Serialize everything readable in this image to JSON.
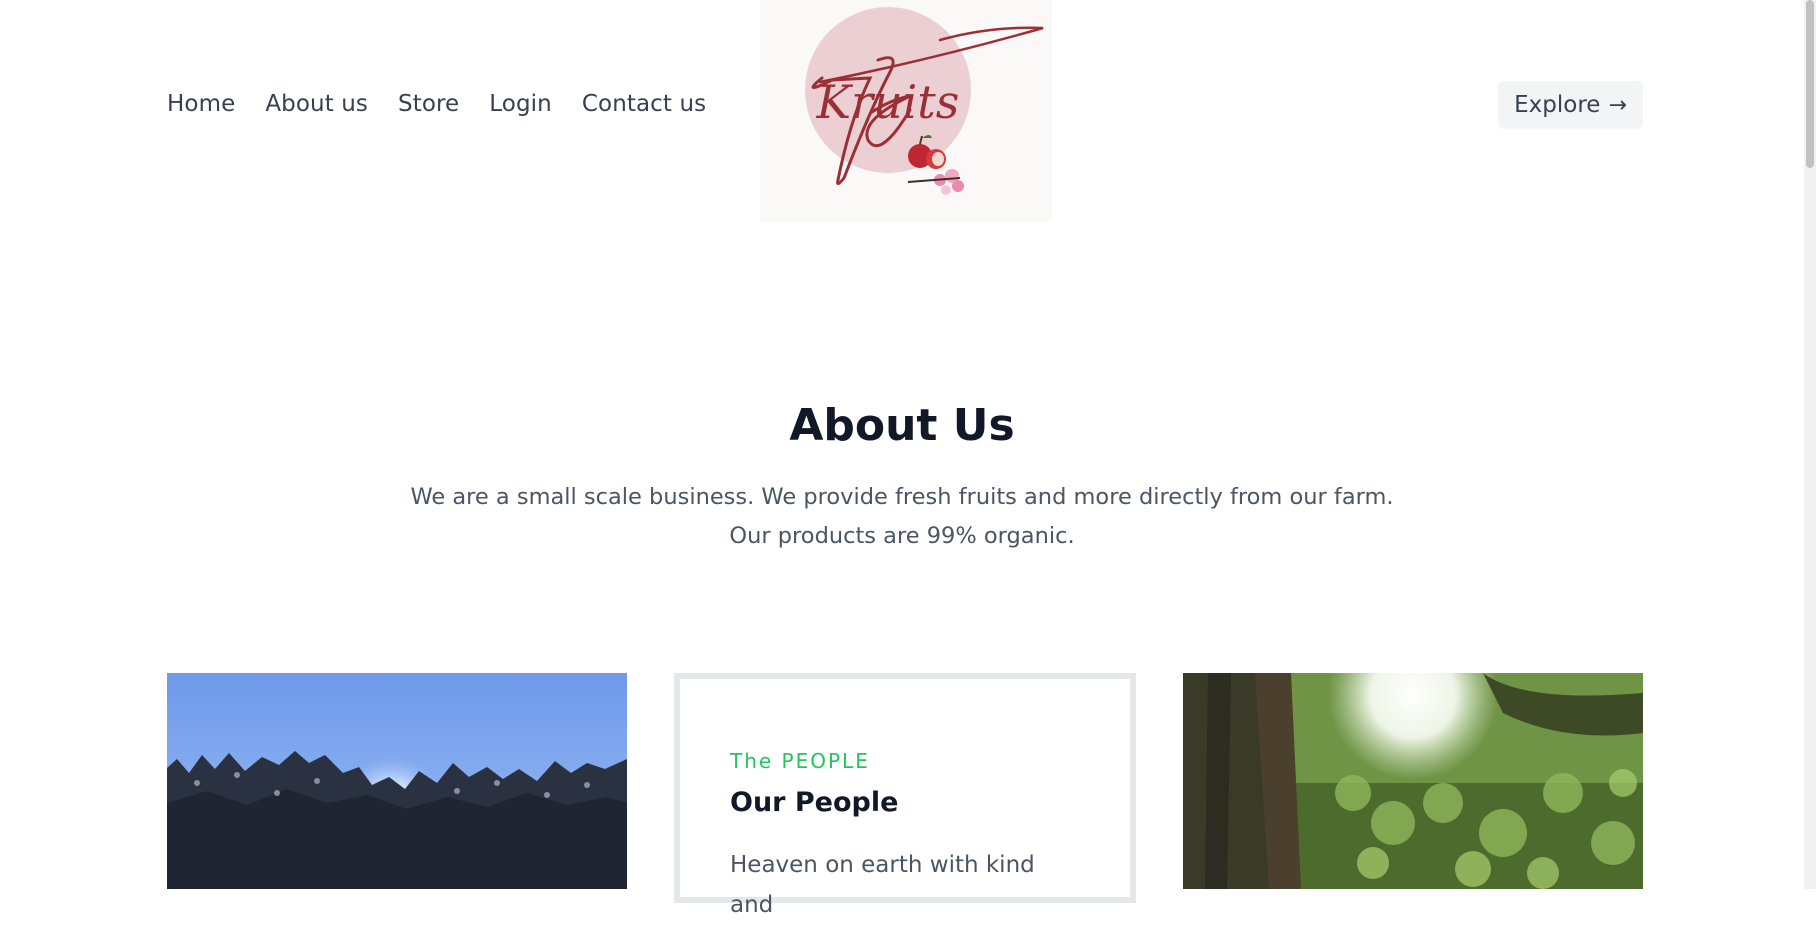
{
  "nav": {
    "items": [
      {
        "label": "Home"
      },
      {
        "label": "About us"
      },
      {
        "label": "Store"
      },
      {
        "label": "Login"
      },
      {
        "label": "Contact us"
      }
    ]
  },
  "logo": {
    "text": "Kruits",
    "colors": {
      "circle": "#ebcfd2",
      "script": "#9b2f36"
    }
  },
  "header": {
    "explore_label": "Explore",
    "explore_icon": "arrow-right-icon"
  },
  "about": {
    "title": "About Us",
    "description": "We are a small scale business. We provide fresh fruits and more directly from our farm. Our products are 99% organic."
  },
  "cards": {
    "people": {
      "eyebrow": "The PEOPLE",
      "title": "Our People",
      "text": "Heaven on earth with kind and"
    }
  },
  "colors": {
    "accent": "#22c55e",
    "heading": "#111827",
    "body": "#4b5563",
    "button_bg": "#f3f4f6",
    "card_border": "#e5e7eb"
  }
}
